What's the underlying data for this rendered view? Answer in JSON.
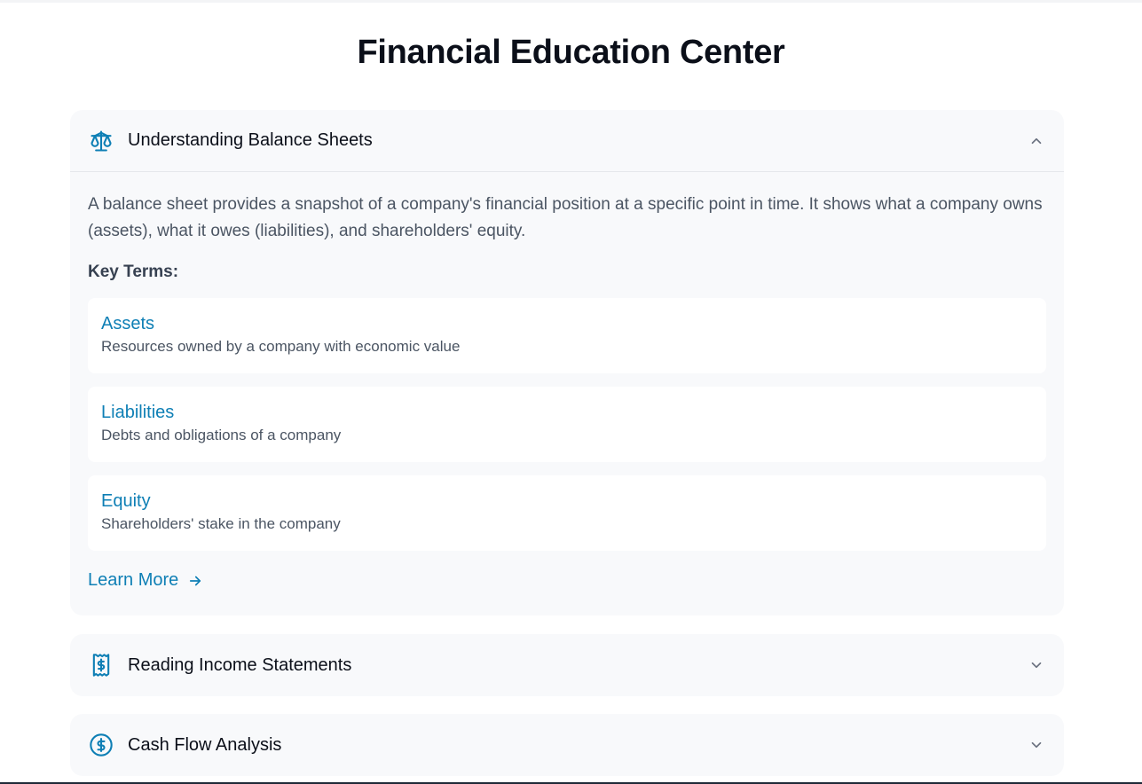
{
  "page": {
    "title": "Financial Education Center"
  },
  "colors": {
    "accent": "#0e7fb5",
    "panel": "#f8f9fb",
    "muted_text": "#4b5563"
  },
  "sections": [
    {
      "title": "Understanding Balance Sheets",
      "icon": "scale-icon",
      "expanded": true,
      "intro": "A balance sheet provides a snapshot of a company's financial position at a specific point in time. It shows what a company owns (assets), what it owes (liabilities), and shareholders' equity.",
      "key_terms_label": "Key Terms:",
      "terms": [
        {
          "name": "Assets",
          "description": "Resources owned by a company with economic value"
        },
        {
          "name": "Liabilities",
          "description": "Debts and obligations of a company"
        },
        {
          "name": "Equity",
          "description": "Shareholders' stake in the company"
        }
      ],
      "learn_more_label": "Learn More"
    },
    {
      "title": "Reading Income Statements",
      "icon": "receipt-icon",
      "expanded": false
    },
    {
      "title": "Cash Flow Analysis",
      "icon": "dollar-circle-icon",
      "expanded": false
    }
  ]
}
